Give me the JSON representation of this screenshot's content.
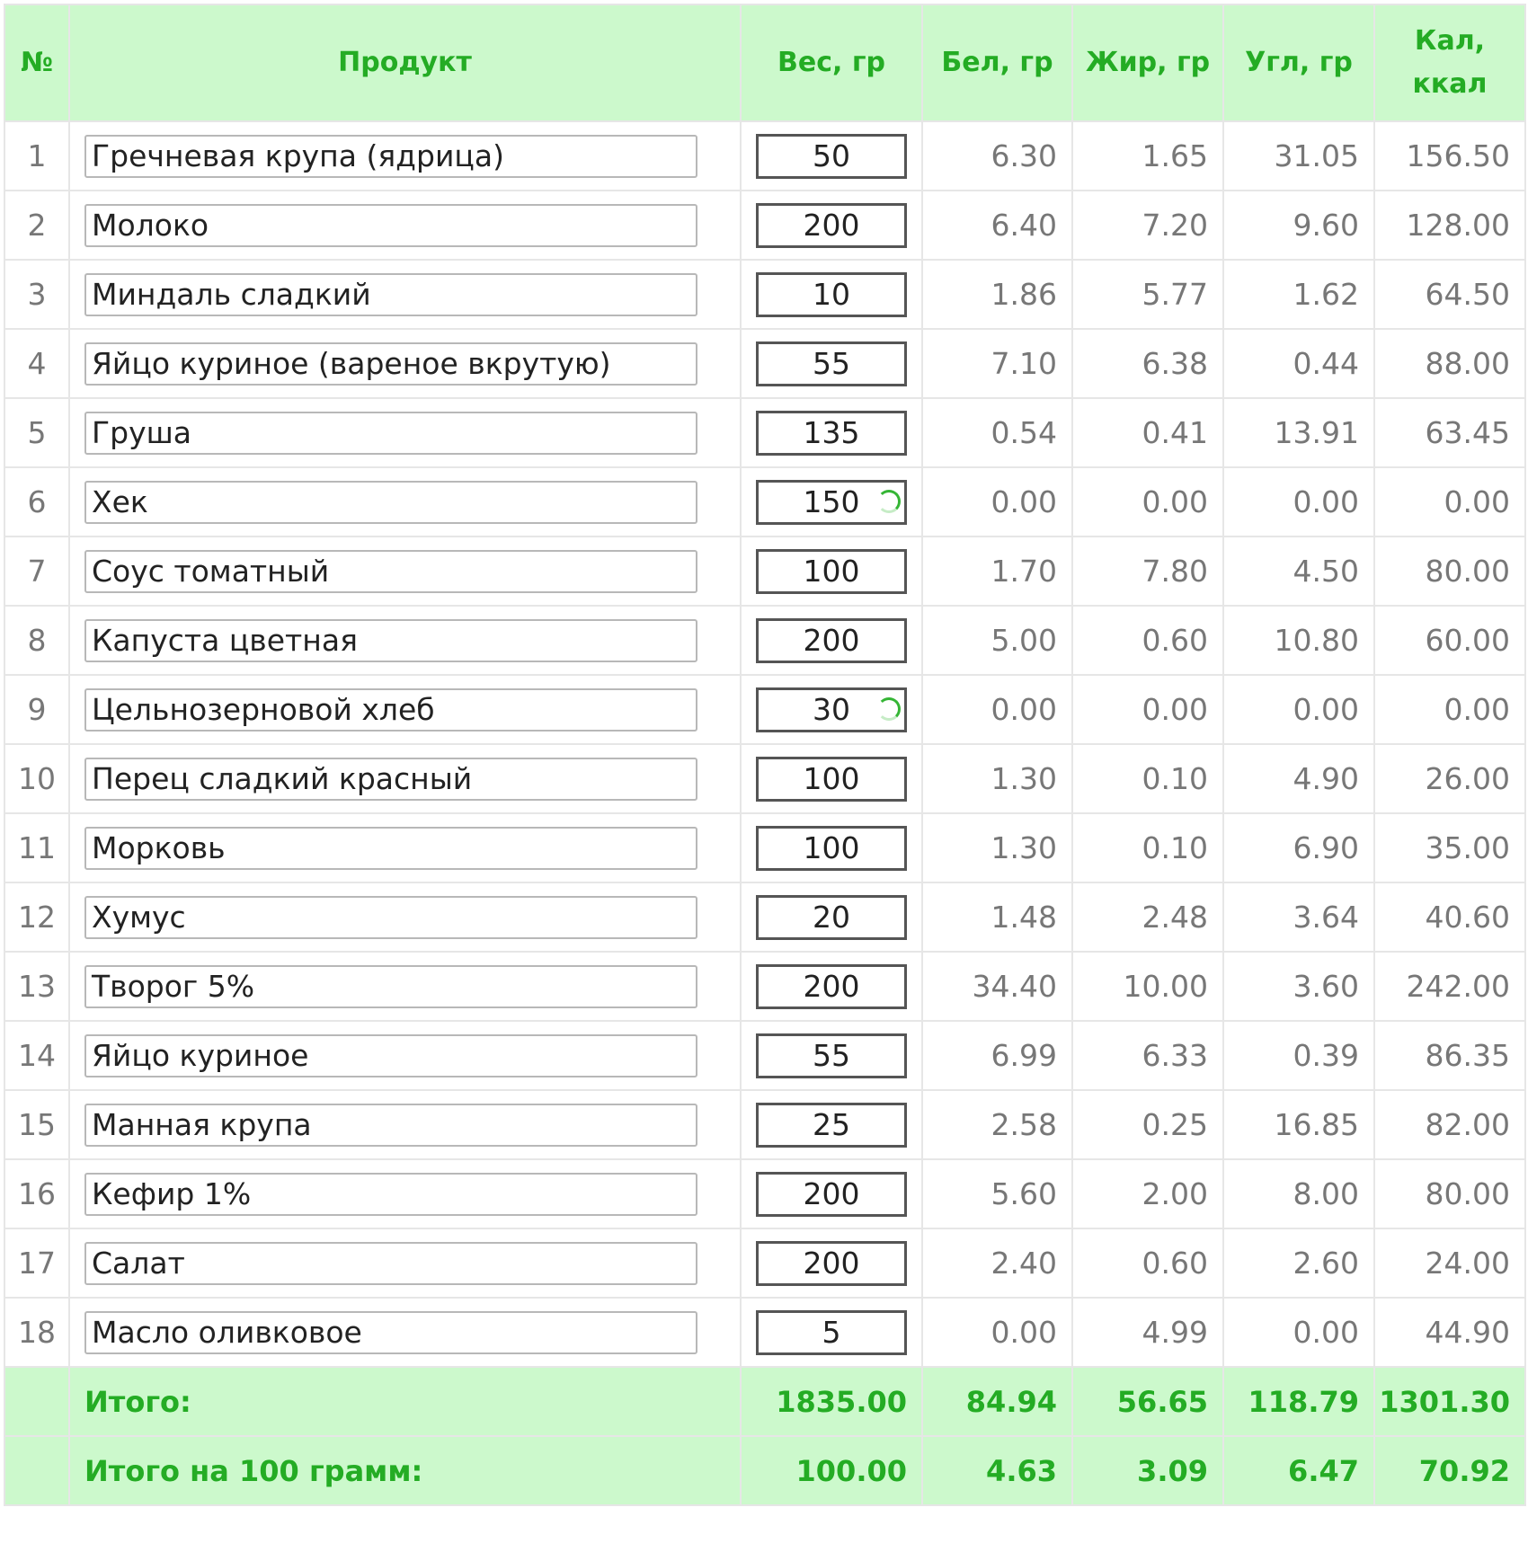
{
  "table": {
    "headers": {
      "num": "№",
      "product": "Продукт",
      "weight": "Вес, гр",
      "protein": "Бел, гр",
      "fat": "Жир, гр",
      "carbs": "Угл, гр",
      "kcal_line1": "Кал,",
      "kcal_line2": "ккал"
    },
    "rows": [
      {
        "n": "1",
        "product": "Гречневая крупа (ядрица)",
        "weight": "50",
        "loading": false,
        "protein": "6.30",
        "fat": "1.65",
        "carbs": "31.05",
        "kcal": "156.50"
      },
      {
        "n": "2",
        "product": "Молоко",
        "weight": "200",
        "loading": false,
        "protein": "6.40",
        "fat": "7.20",
        "carbs": "9.60",
        "kcal": "128.00"
      },
      {
        "n": "3",
        "product": "Миндаль сладкий",
        "weight": "10",
        "loading": false,
        "protein": "1.86",
        "fat": "5.77",
        "carbs": "1.62",
        "kcal": "64.50"
      },
      {
        "n": "4",
        "product": "Яйцо куриное (вареное вкрутую)",
        "weight": "55",
        "loading": false,
        "protein": "7.10",
        "fat": "6.38",
        "carbs": "0.44",
        "kcal": "88.00"
      },
      {
        "n": "5",
        "product": "Груша",
        "weight": "135",
        "loading": false,
        "protein": "0.54",
        "fat": "0.41",
        "carbs": "13.91",
        "kcal": "63.45"
      },
      {
        "n": "6",
        "product": "Хек",
        "weight": "150",
        "loading": true,
        "protein": "0.00",
        "fat": "0.00",
        "carbs": "0.00",
        "kcal": "0.00"
      },
      {
        "n": "7",
        "product": "Соус томатный",
        "weight": "100",
        "loading": false,
        "protein": "1.70",
        "fat": "7.80",
        "carbs": "4.50",
        "kcal": "80.00"
      },
      {
        "n": "8",
        "product": "Капуста цветная",
        "weight": "200",
        "loading": false,
        "protein": "5.00",
        "fat": "0.60",
        "carbs": "10.80",
        "kcal": "60.00"
      },
      {
        "n": "9",
        "product": "Цельнозерновой хлеб",
        "weight": "30",
        "loading": true,
        "protein": "0.00",
        "fat": "0.00",
        "carbs": "0.00",
        "kcal": "0.00"
      },
      {
        "n": "10",
        "product": "Перец сладкий красный",
        "weight": "100",
        "loading": false,
        "protein": "1.30",
        "fat": "0.10",
        "carbs": "4.90",
        "kcal": "26.00"
      },
      {
        "n": "11",
        "product": "Морковь",
        "weight": "100",
        "loading": false,
        "protein": "1.30",
        "fat": "0.10",
        "carbs": "6.90",
        "kcal": "35.00"
      },
      {
        "n": "12",
        "product": "Хумус",
        "weight": "20",
        "loading": false,
        "protein": "1.48",
        "fat": "2.48",
        "carbs": "3.64",
        "kcal": "40.60"
      },
      {
        "n": "13",
        "product": "Творог 5%",
        "weight": "200",
        "loading": false,
        "protein": "34.40",
        "fat": "10.00",
        "carbs": "3.60",
        "kcal": "242.00"
      },
      {
        "n": "14",
        "product": "Яйцо куриное",
        "weight": "55",
        "loading": false,
        "protein": "6.99",
        "fat": "6.33",
        "carbs": "0.39",
        "kcal": "86.35"
      },
      {
        "n": "15",
        "product": "Манная крупа",
        "weight": "25",
        "loading": false,
        "protein": "2.58",
        "fat": "0.25",
        "carbs": "16.85",
        "kcal": "82.00"
      },
      {
        "n": "16",
        "product": "Кефир 1%",
        "weight": "200",
        "loading": false,
        "protein": "5.60",
        "fat": "2.00",
        "carbs": "8.00",
        "kcal": "80.00"
      },
      {
        "n": "17",
        "product": "Салат",
        "weight": "200",
        "loading": false,
        "protein": "2.40",
        "fat": "0.60",
        "carbs": "2.60",
        "kcal": "24.00"
      },
      {
        "n": "18",
        "product": "Масло оливковое",
        "weight": "5",
        "loading": false,
        "protein": "0.00",
        "fat": "4.99",
        "carbs": "0.00",
        "kcal": "44.90"
      }
    ],
    "totals": [
      {
        "label": "Итого:",
        "weight": "1835.00",
        "protein": "84.94",
        "fat": "56.65",
        "carbs": "118.79",
        "kcal": "1301.30"
      },
      {
        "label": "Итого на 100 грамм:",
        "weight": "100.00",
        "protein": "4.63",
        "fat": "3.09",
        "carbs": "6.47",
        "kcal": "70.92"
      }
    ]
  },
  "colors": {
    "header_bg": "#ccf9cc",
    "accent_green": "#24ac24",
    "cell_text": "#777777",
    "grid_line": "#e6e6e6"
  }
}
